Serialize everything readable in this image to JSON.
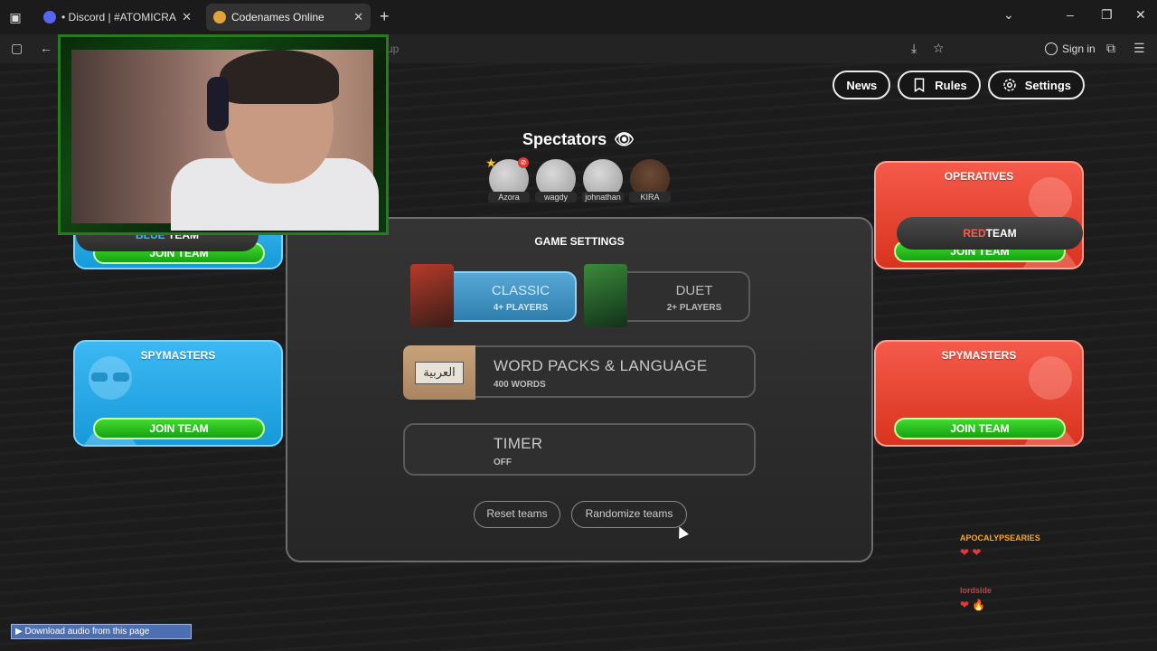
{
  "browser": {
    "tabs": [
      {
        "label": "• Discord | #ATOMICRA",
        "active": false
      },
      {
        "label": "Codenames Online",
        "active": true
      }
    ],
    "new_tab": "+",
    "url_partial": "up",
    "signin_label": "Sign in"
  },
  "nav": {
    "news": "News",
    "rules": "Rules",
    "settings": "Settings"
  },
  "spectators": {
    "title": "Spectators",
    "players": [
      {
        "name": "Azora"
      },
      {
        "name": "wagdy"
      },
      {
        "name": "johnathan"
      },
      {
        "name": "KIRA"
      }
    ]
  },
  "blue_team": {
    "bar_word": "BLUE",
    "bar_suffix": "TEAM",
    "join_label_top": "JOIN TEAM",
    "spymasters_title": "SPYMASTERS",
    "join_label": "JOIN TEAM"
  },
  "red_team": {
    "operatives_title": "OPERATIVES",
    "bar_word": "RED",
    "bar_suffix": "TEAM",
    "join_label_top": "JOIN TEAM",
    "spymasters_title": "SPYMASTERS",
    "join_label": "JOIN TEAM"
  },
  "game_settings": {
    "title": "GAME SETTINGS",
    "modes": [
      {
        "name": "CLASSIC",
        "sub": "4+ PLAYERS",
        "active": true
      },
      {
        "name": "DUET",
        "sub": "2+ PLAYERS",
        "active": false
      }
    ],
    "word_packs": {
      "title": "WORD PACKS & LANGUAGE",
      "sub": "400 WORDS",
      "lang_label": "العربية"
    },
    "timer": {
      "title": "TIMER",
      "sub": "OFF"
    },
    "reset_label": "Reset teams",
    "randomize_label": "Randomize teams"
  },
  "chat": {
    "user1": "APOCALYPSEARIES",
    "user2": "lordside"
  },
  "download_bar": "▶ Download audio from this page",
  "colors": {
    "blue": "#169ad9",
    "red": "#d9331f",
    "green": "#14a312"
  }
}
